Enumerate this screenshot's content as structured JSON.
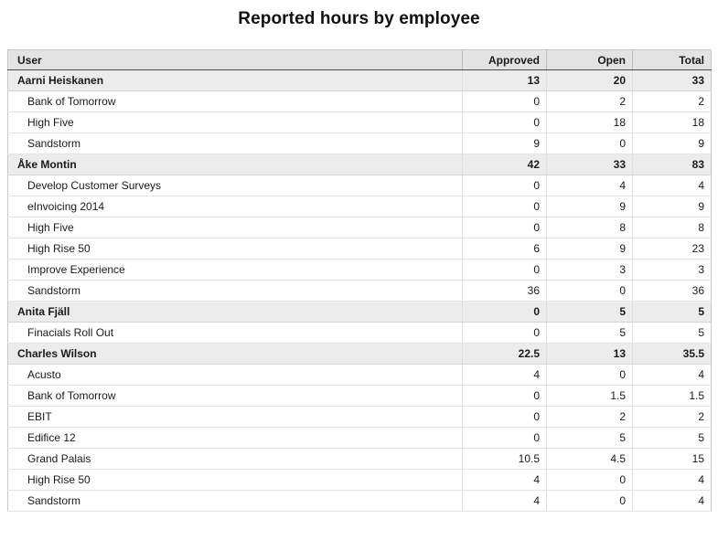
{
  "page": {
    "title": "Reported hours by employee"
  },
  "table": {
    "columns": [
      {
        "key": "user",
        "label": "User",
        "align": "left"
      },
      {
        "key": "approved",
        "label": "Approved",
        "align": "right"
      },
      {
        "key": "open",
        "label": "Open",
        "align": "right"
      },
      {
        "key": "total",
        "label": "Total",
        "align": "right"
      }
    ],
    "rows": [
      {
        "type": "group",
        "user": "Aarni Heiskanen",
        "approved": "13",
        "open": "20",
        "total": "33"
      },
      {
        "type": "detail",
        "user": "Bank of Tomorrow",
        "approved": "0",
        "open": "2",
        "total": "2"
      },
      {
        "type": "detail",
        "user": "High Five",
        "approved": "0",
        "open": "18",
        "total": "18"
      },
      {
        "type": "detail",
        "user": "Sandstorm",
        "approved": "9",
        "open": "0",
        "total": "9"
      },
      {
        "type": "group",
        "user": "Åke Montin",
        "approved": "42",
        "open": "33",
        "total": "83"
      },
      {
        "type": "detail",
        "user": "Develop Customer Surveys",
        "approved": "0",
        "open": "4",
        "total": "4"
      },
      {
        "type": "detail",
        "user": "eInvoicing 2014",
        "approved": "0",
        "open": "9",
        "total": "9"
      },
      {
        "type": "detail",
        "user": "High Five",
        "approved": "0",
        "open": "8",
        "total": "8"
      },
      {
        "type": "detail",
        "user": "High Rise 50",
        "approved": "6",
        "open": "9",
        "total": "23"
      },
      {
        "type": "detail",
        "user": "Improve Experience",
        "approved": "0",
        "open": "3",
        "total": "3"
      },
      {
        "type": "detail",
        "user": "Sandstorm",
        "approved": "36",
        "open": "0",
        "total": "36"
      },
      {
        "type": "group",
        "user": "Anita Fjäll",
        "approved": "0",
        "open": "5",
        "total": "5"
      },
      {
        "type": "detail",
        "user": "Finacials Roll Out",
        "approved": "0",
        "open": "5",
        "total": "5"
      },
      {
        "type": "group",
        "user": "Charles Wilson",
        "approved": "22.5",
        "open": "13",
        "total": "35.5"
      },
      {
        "type": "detail",
        "user": "Acusto",
        "approved": "4",
        "open": "0",
        "total": "4"
      },
      {
        "type": "detail",
        "user": "Bank of Tomorrow",
        "approved": "0",
        "open": "1.5",
        "total": "1.5"
      },
      {
        "type": "detail",
        "user": "EBIT",
        "approved": "0",
        "open": "2",
        "total": "2"
      },
      {
        "type": "detail",
        "user": "Edifice 12",
        "approved": "0",
        "open": "5",
        "total": "5"
      },
      {
        "type": "detail",
        "user": "Grand Palais",
        "approved": "10.5",
        "open": "4.5",
        "total": "15"
      },
      {
        "type": "detail",
        "user": "High Rise 50",
        "approved": "4",
        "open": "0",
        "total": "4"
      },
      {
        "type": "detail",
        "user": "Sandstorm",
        "approved": "4",
        "open": "0",
        "total": "4"
      }
    ]
  }
}
